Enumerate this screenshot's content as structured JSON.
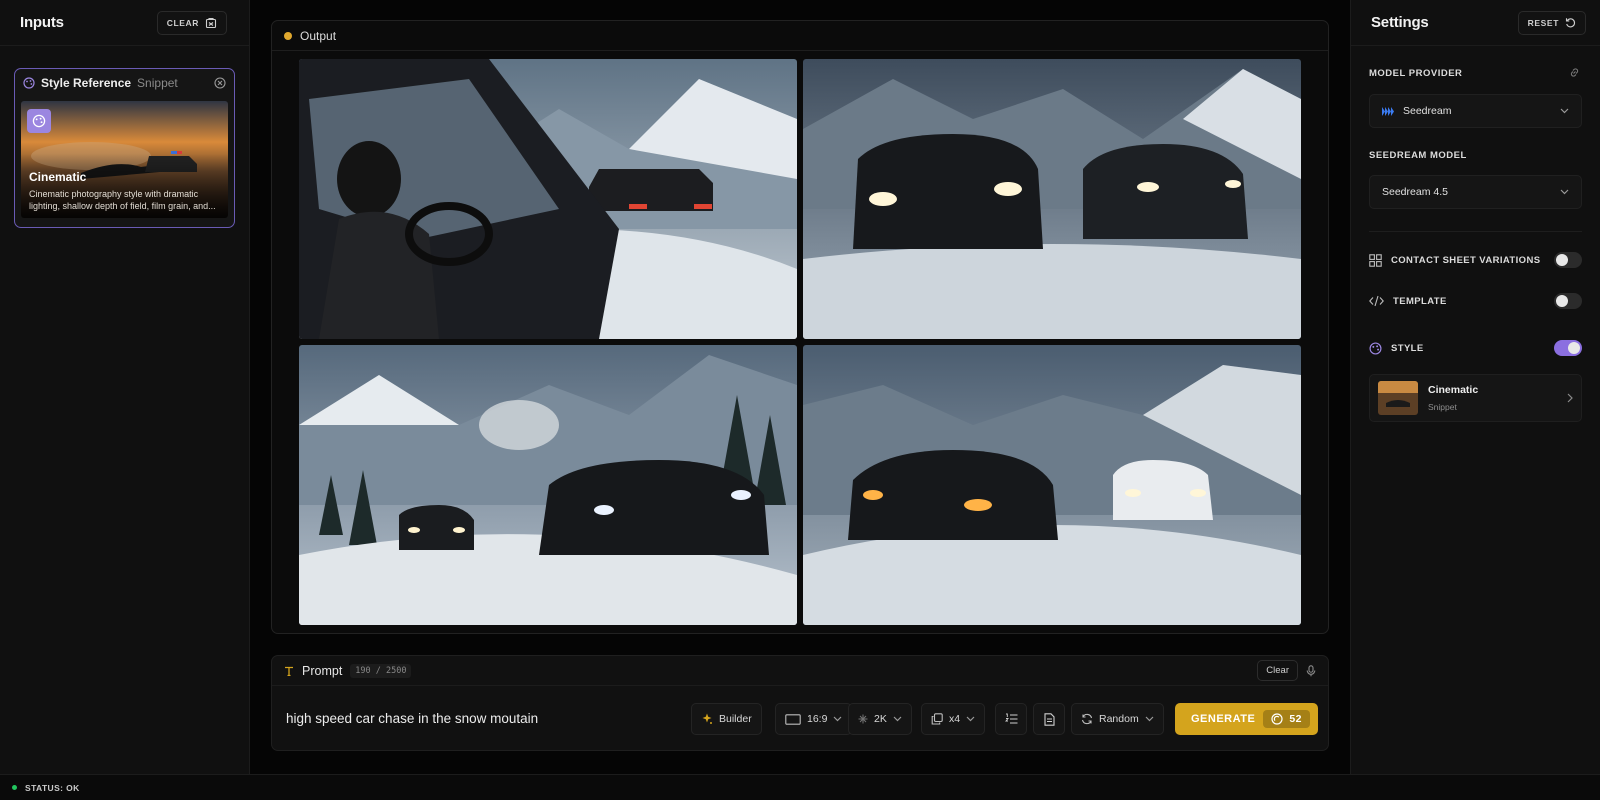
{
  "inputs": {
    "title": "Inputs",
    "clear_label": "CLEAR",
    "style_ref": {
      "title": "Style Reference",
      "tag": "Snippet",
      "name": "Cinematic",
      "description": "Cinematic photography style with dramatic lighting, shallow depth of field, film grain, and..."
    }
  },
  "output": {
    "title": "Output",
    "status_color": "#e0a82e",
    "images": [
      {
        "icon": "snow-car-chase-interior-image"
      },
      {
        "icon": "two-black-cars-snow-image"
      },
      {
        "icon": "supercars-mountain-road-image"
      },
      {
        "icon": "sports-car-suv-snow-image"
      }
    ]
  },
  "prompt": {
    "label": "Prompt",
    "counter": "190 / 2500",
    "clear_label": "Clear",
    "text": "high speed car chase in the snow moutain",
    "builder_label": "Builder",
    "aspect_label": "16:9",
    "resolution_label": "2K",
    "count_label": "x4",
    "seed_label": "Random",
    "generate_label": "GENERATE",
    "credits": "52"
  },
  "settings": {
    "title": "Settings",
    "reset_label": "RESET",
    "model_provider_label": "MODEL PROVIDER",
    "model_provider_value": "Seedream",
    "model_label": "SEEDREAM MODEL",
    "model_value": "Seedream 4.5",
    "contact_sheet_label": "CONTACT SHEET VARIATIONS",
    "contact_sheet_on": false,
    "template_label": "TEMPLATE",
    "template_on": false,
    "style_label": "STYLE",
    "style_on": true,
    "style_item_name": "Cinematic",
    "style_item_tag": "Snippet"
  },
  "status": {
    "text": "STATUS: OK",
    "color": "#22c55e"
  },
  "colors": {
    "accent": "#d4a41d",
    "purple": "#8b6fe0"
  }
}
